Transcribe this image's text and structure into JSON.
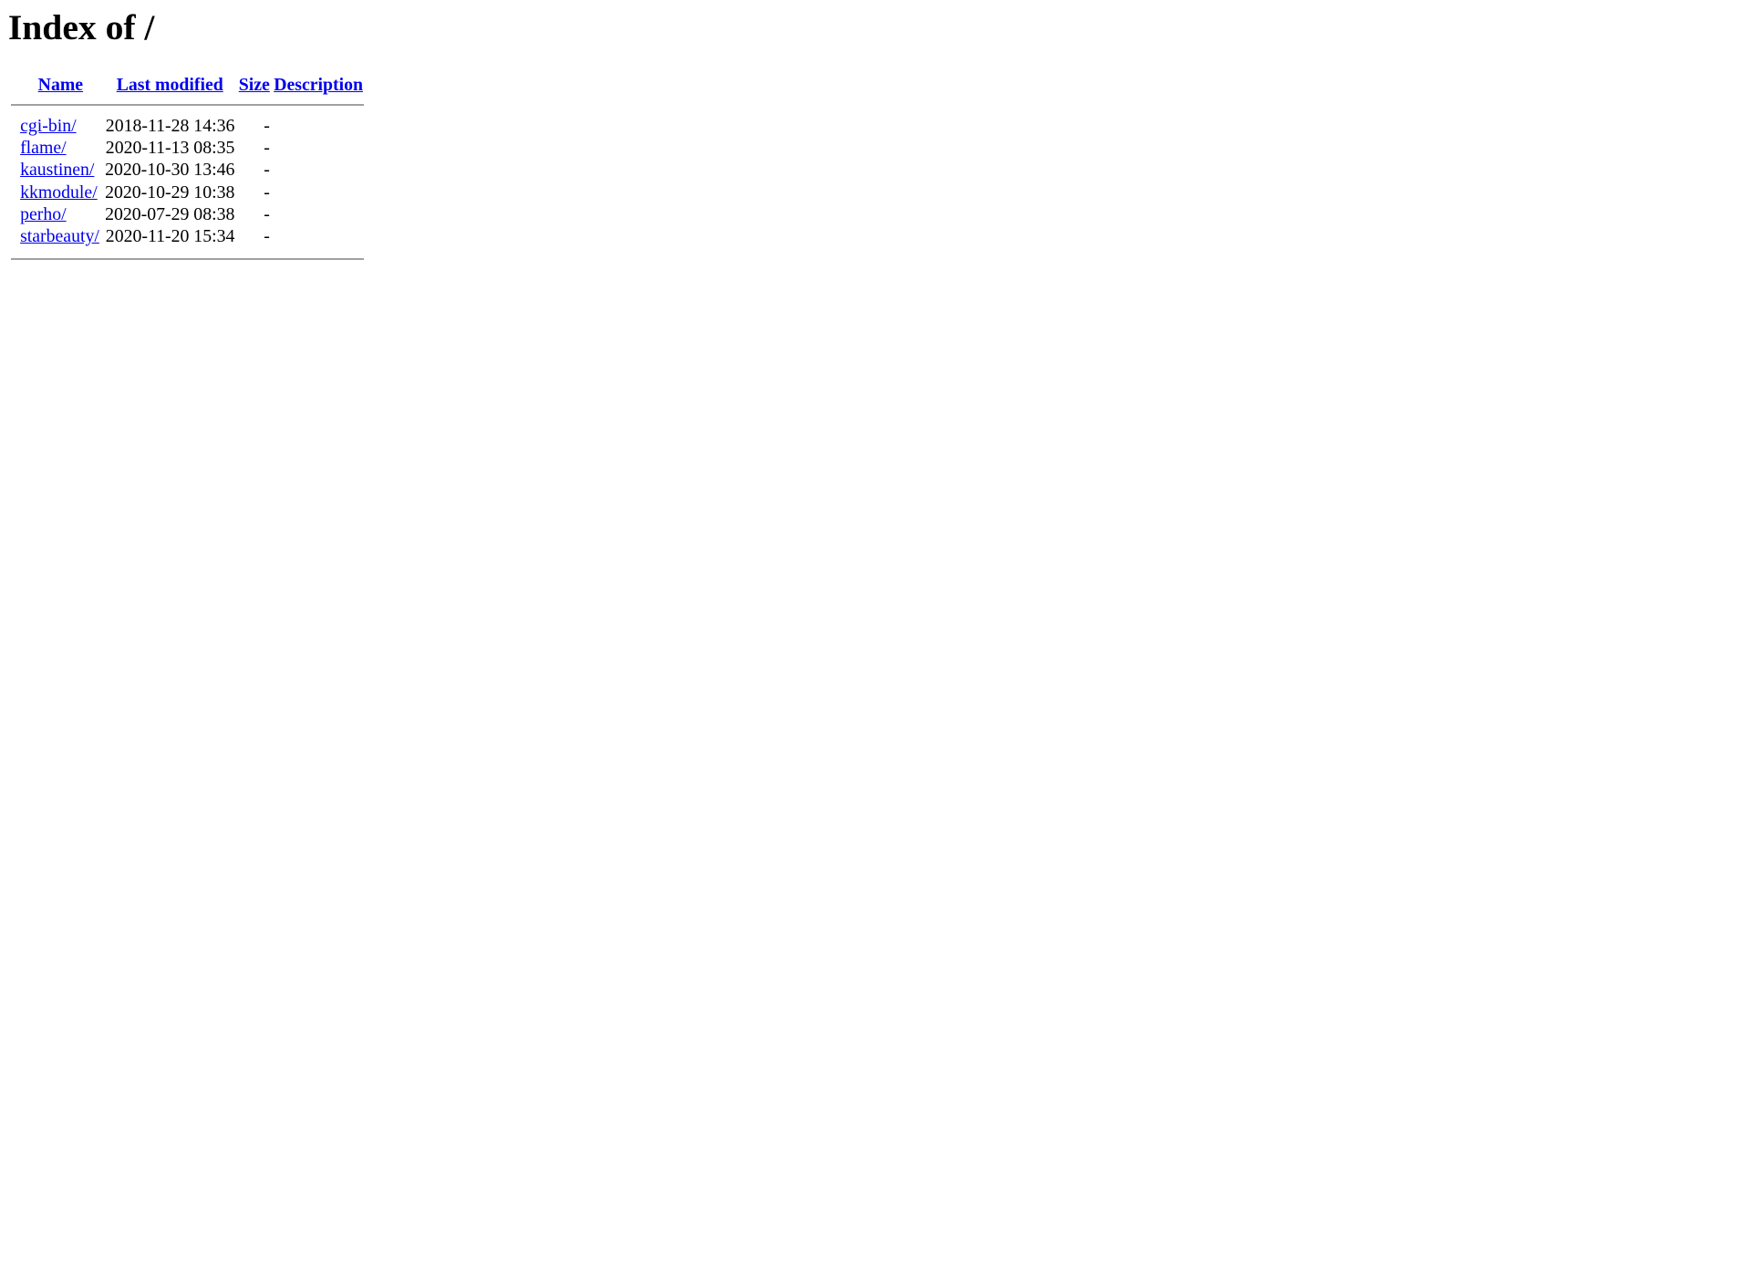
{
  "page": {
    "title": "Index of /"
  },
  "table": {
    "headers": {
      "name": "Name",
      "last_modified": "Last modified",
      "size": "Size",
      "description": "Description"
    },
    "rows": [
      {
        "name": "cgi-bin/",
        "last_modified": "2018-11-28 14:36",
        "size": "-",
        "description": ""
      },
      {
        "name": "flame/",
        "last_modified": "2020-11-13 08:35",
        "size": "-",
        "description": ""
      },
      {
        "name": "kaustinen/",
        "last_modified": "2020-10-30 13:46",
        "size": "-",
        "description": ""
      },
      {
        "name": "kkmodule/",
        "last_modified": "2020-10-29 10:38",
        "size": "-",
        "description": ""
      },
      {
        "name": "perho/",
        "last_modified": "2020-07-29 08:38",
        "size": "-",
        "description": ""
      },
      {
        "name": "starbeauty/",
        "last_modified": "2020-11-20 15:34",
        "size": "-",
        "description": ""
      }
    ]
  },
  "colors": {
    "link": "#0000ee",
    "rule": "#a0a0a0",
    "text": "#000000",
    "background": "#ffffff"
  }
}
